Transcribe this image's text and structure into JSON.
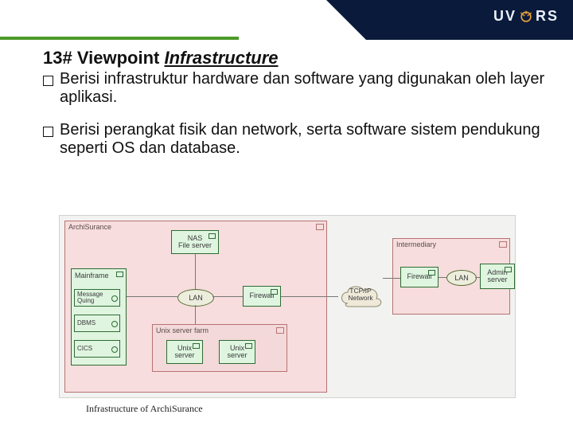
{
  "header": {
    "logo_left": "UV",
    "logo_right": "RS"
  },
  "title": {
    "number": "13#",
    "label": "Viewpoint",
    "emph": "Infrastructure"
  },
  "bullets": [
    "Berisi infrastruktur hardware dan software yang digunakan oleh layer aplikasi.",
    "Berisi perangkat fisik dan network, serta software sistem pendukung seperti OS dan database."
  ],
  "diagram": {
    "groups": {
      "archisurance": "ArchiSurance",
      "intermediary": "Intermediary",
      "serverfarm": "Unix server farm"
    },
    "nodes": {
      "nas": "NAS\nFile server",
      "mainframe": "Mainframe",
      "firewall1": "Firewall",
      "firewall2": "Firewall",
      "admin": "Admin\nserver",
      "unix1": "Unix\nserver",
      "unix2": "Unix\nserver",
      "mq": "Message\nQuing",
      "dbms": "DBMS",
      "cics": "CICS"
    },
    "ovals": {
      "lan1": "LAN",
      "lan2": "LAN"
    },
    "cloud": "TCP/IP\nNetwork",
    "caption": "Infrastructure of ArchiSurance"
  }
}
